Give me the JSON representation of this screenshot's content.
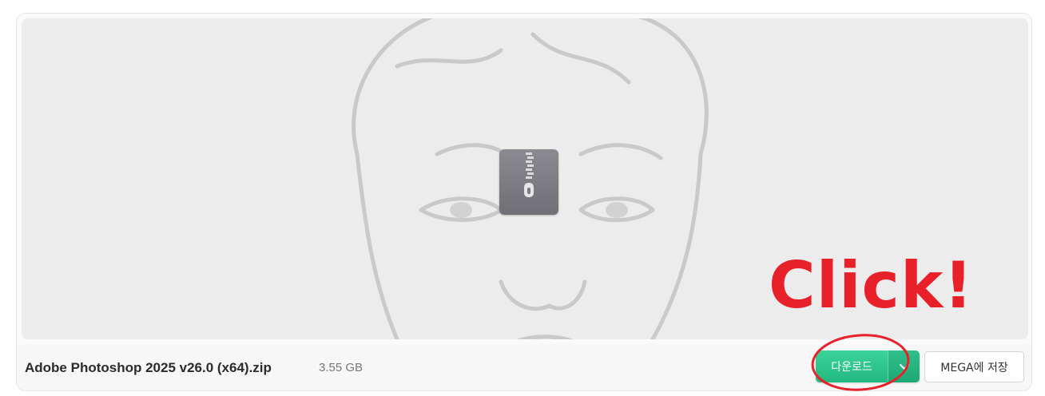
{
  "file": {
    "name": "Adobe Photoshop 2025 v26.0 (x64).zip",
    "size": "3.55 GB"
  },
  "preview": {
    "icon": "zip-archive-icon",
    "background_image": "line-drawing-face-portrait"
  },
  "actions": {
    "download_label": "다운로드",
    "download_dropdown_icon": "chevron-down-icon",
    "save_to_mega_label": "MEGA에 저장"
  },
  "annotation": {
    "text": "Click!",
    "color": "#e8202a"
  },
  "colors": {
    "download_button": "#2ac68c",
    "annotation": "#e8202a",
    "preview_bg": "#ececec"
  }
}
